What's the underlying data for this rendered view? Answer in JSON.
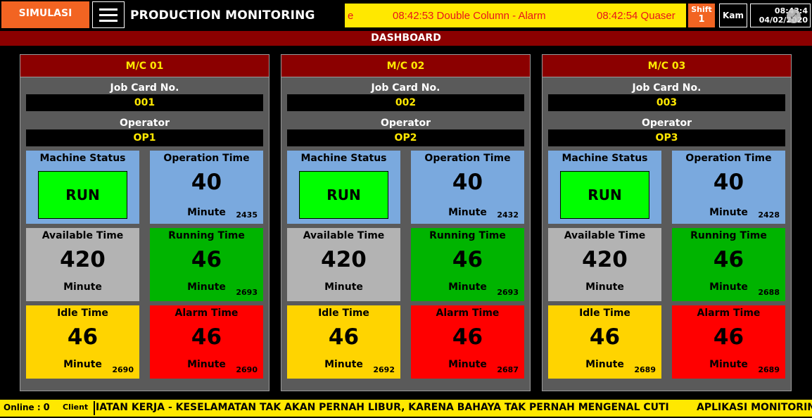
{
  "header": {
    "sim_label": "SIMULASI",
    "title": "PRODUCTION MONITORING",
    "ticker_fragment": "e",
    "ticker_1": "08:42:53 Double Column - Alarm",
    "ticker_2": "08:42:54 Quaser",
    "shift_label": "Shift",
    "shift_value": "1",
    "day": "Kam",
    "time": "08:43:4",
    "date": "04/02/2020"
  },
  "dashboard_label": "DASHBOARD",
  "labels": {
    "job_card": "Job Card No.",
    "operator": "Operator",
    "machine_status": "Machine Status",
    "operation_time": "Operation Time",
    "available_time": "Available Time",
    "running_time": "Running Time",
    "idle_time": "Idle Time",
    "alarm_time": "Alarm Time",
    "unit": "Minute"
  },
  "machines": [
    {
      "name": "M/C 01",
      "job_card": "001",
      "operator": "OP1",
      "status": "RUN",
      "operation_time": "40",
      "operation_count": "2435",
      "available_time": "420",
      "running_time": "46",
      "running_count": "2693",
      "idle_time": "46",
      "idle_count": "2690",
      "alarm_time": "46",
      "alarm_count": "2690"
    },
    {
      "name": "M/C 02",
      "job_card": "002",
      "operator": "OP2",
      "status": "RUN",
      "operation_time": "40",
      "operation_count": "2432",
      "available_time": "420",
      "running_time": "46",
      "running_count": "2693",
      "idle_time": "46",
      "idle_count": "2692",
      "alarm_time": "46",
      "alarm_count": "2687"
    },
    {
      "name": "M/C 03",
      "job_card": "003",
      "operator": "OP3",
      "status": "RUN",
      "operation_time": "40",
      "operation_count": "2428",
      "available_time": "420",
      "running_time": "46",
      "running_count": "2688",
      "idle_time": "46",
      "idle_count": "2689",
      "alarm_time": "46",
      "alarm_count": "2689"
    }
  ],
  "footer": {
    "online_label": "Online :",
    "online_count": "0",
    "client_label": "Client",
    "ticker": "IATAN KERJA  -  KESELAMATAN TAK AKAN PERNAH LIBUR, KARENA BAHAYA TAK PERNAH MENGENAL CUTI",
    "ticker_2": "APLIKASI MONITORIN"
  },
  "colors": {
    "header_red": "#8b0000",
    "accent_orange": "#f26422",
    "ticker_yellow": "#ffe800",
    "run_green": "#00ff00",
    "running_green": "#00b400",
    "alarm_red": "#ff0000",
    "idle_yellow": "#ffd400",
    "operation_blue": "#7aa9de",
    "available_gray": "#b3b3b3"
  },
  "icons": [
    "hamburger-menu-icon",
    "fullscreen-icon"
  ]
}
